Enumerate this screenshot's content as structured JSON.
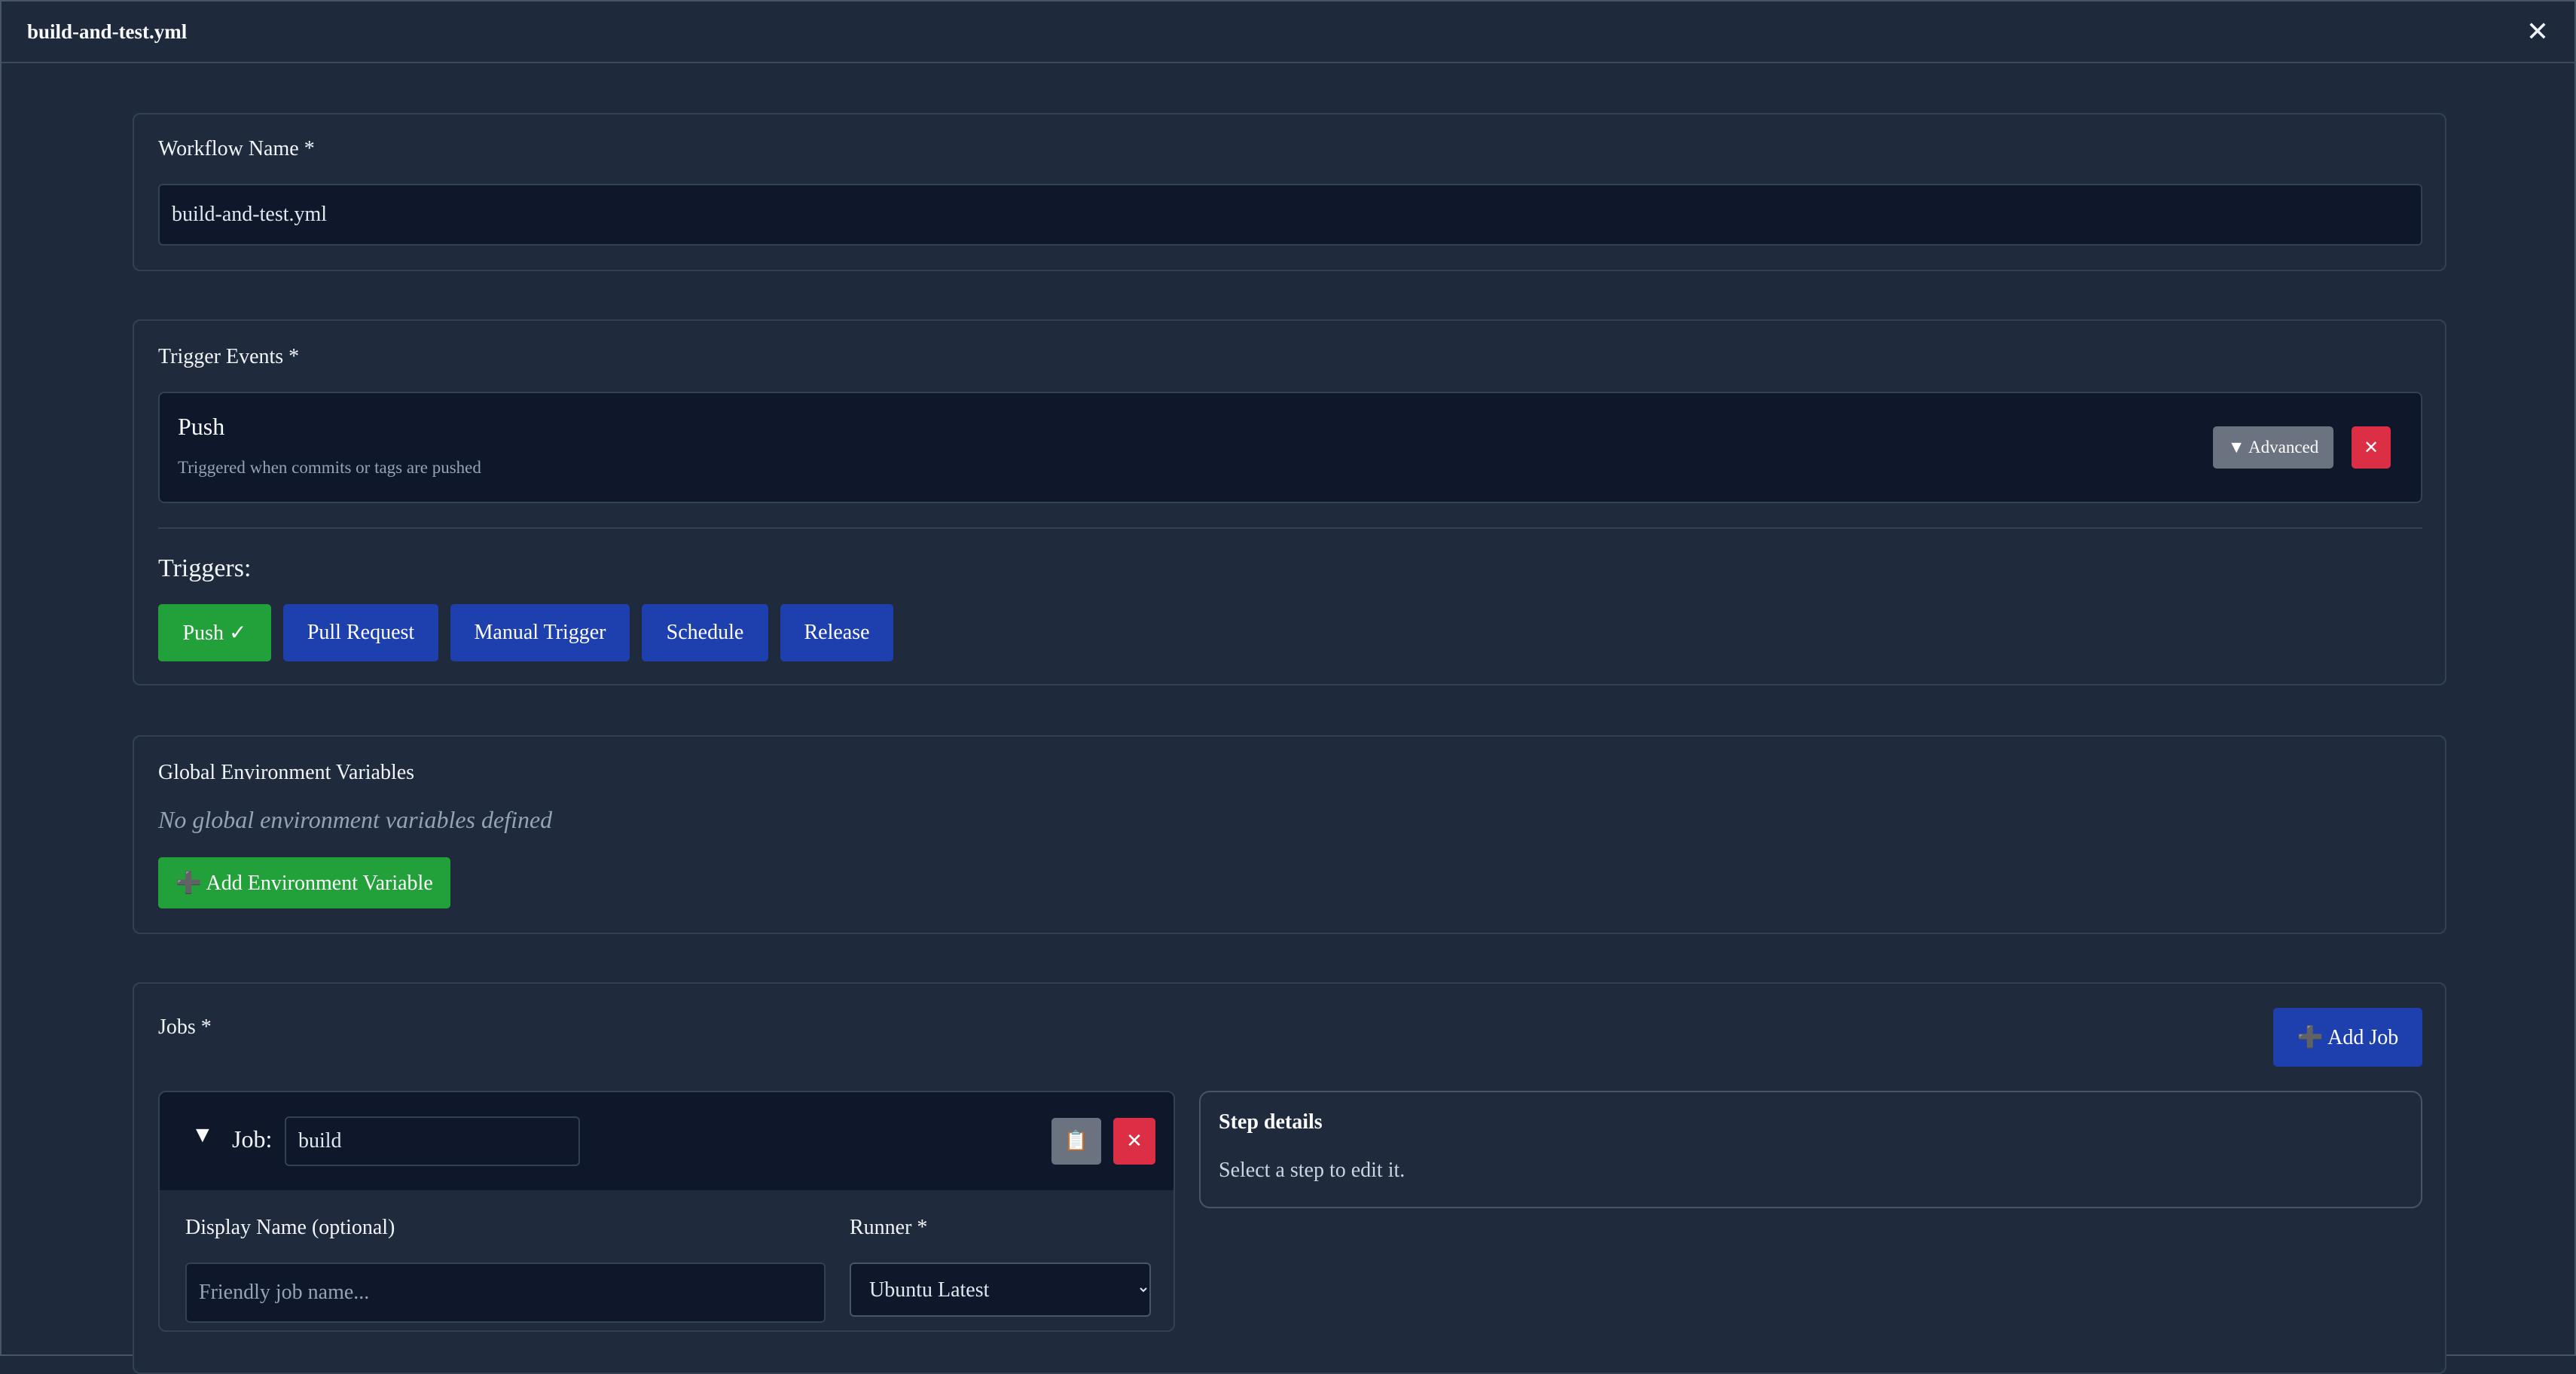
{
  "window": {
    "title": "build-and-test.yml",
    "close_glyph": "✕"
  },
  "workflow": {
    "label": "Workflow Name *",
    "value": "build-and-test.yml"
  },
  "triggers_card": {
    "label": "Trigger Events *",
    "selected": {
      "name": "Push",
      "description": "Triggered when commits or tags are pushed",
      "advanced_label": "▼ Advanced",
      "remove_glyph": "✕"
    },
    "heading": "Triggers:",
    "options": [
      {
        "label": "Push ✓",
        "active": true
      },
      {
        "label": "Pull Request",
        "active": false
      },
      {
        "label": "Manual Trigger",
        "active": false
      },
      {
        "label": "Schedule",
        "active": false
      },
      {
        "label": "Release",
        "active": false
      }
    ]
  },
  "env": {
    "label": "Global Environment Variables",
    "empty_text": "No global environment variables defined",
    "add_label": "➕ Add Environment Variable"
  },
  "jobs": {
    "label": "Jobs *",
    "add_label": "➕ Add Job",
    "job": {
      "toggle_glyph": "▼",
      "prefix": "Job:",
      "name_value": "build",
      "copy_glyph": "📋",
      "remove_glyph": "✕",
      "display_name_label": "Display Name (optional)",
      "display_name_placeholder": "Friendly job name...",
      "runner_label": "Runner *",
      "runner_value": "Ubuntu Latest"
    },
    "step_details": {
      "title": "Step details",
      "hint": "Select a step to edit it."
    }
  },
  "colors": {
    "background": "#1e293b",
    "input_bg": "#0f172a",
    "primary_blue": "#1e40af",
    "success_green": "#22a13a",
    "danger_red": "#dc2f45",
    "neutral_gray": "#6b7280"
  }
}
